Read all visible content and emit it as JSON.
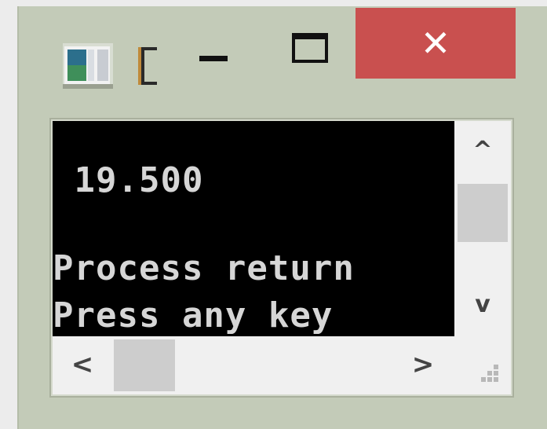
{
  "window": {
    "title_fragment": "",
    "close_glyph": "✕",
    "console_lines": [
      " 19.500",
      "Process return",
      "Press any key"
    ],
    "scroll_glyphs": {
      "up": "^",
      "down": "v",
      "left": "<",
      "right": ">"
    },
    "colors": {
      "frame": "#c3cbb8",
      "close": "#c9504f",
      "console_bg": "#000000",
      "console_text": "#d6d6d6"
    }
  }
}
